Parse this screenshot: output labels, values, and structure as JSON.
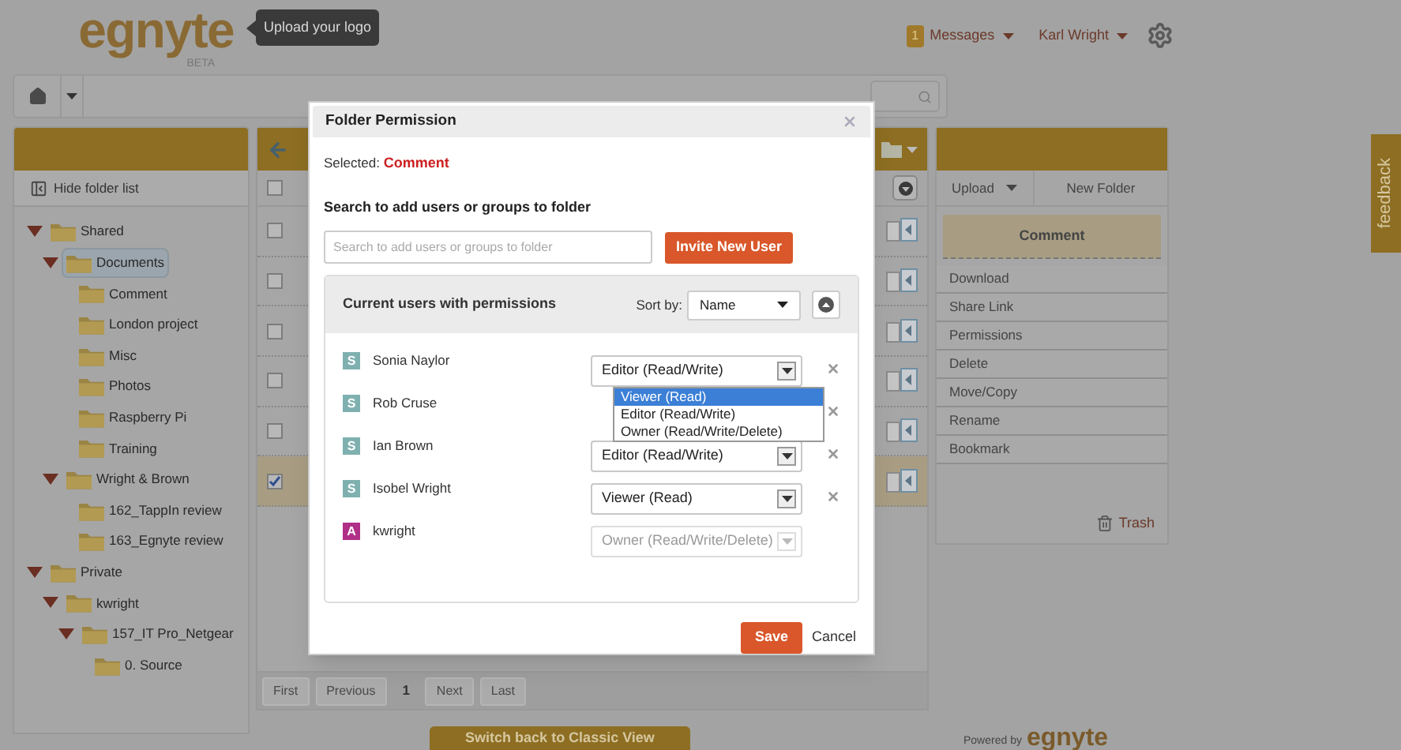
{
  "header": {
    "logo": "egnyte",
    "logo_sub": "BETA",
    "logo_tooltip": "Upload your logo",
    "messages_count": "1",
    "messages": "Messages",
    "user": "Karl Wright"
  },
  "folder_panel": {
    "hide_label": "Hide folder list",
    "tree": [
      {
        "label": "Shared",
        "expanded": true,
        "selected": false,
        "children": [
          {
            "label": "Documents",
            "expanded": true,
            "selected": true,
            "children": [
              {
                "label": "Comment",
                "selected": false
              },
              {
                "label": "London project",
                "selected": false
              },
              {
                "label": "Misc",
                "selected": false
              },
              {
                "label": "Photos",
                "selected": false
              },
              {
                "label": "Raspberry Pi",
                "selected": false
              },
              {
                "label": "Training",
                "selected": false
              }
            ]
          },
          {
            "label": "Wright & Brown",
            "expanded": true,
            "selected": false,
            "children": [
              {
                "label": "162_TappIn review",
                "selected": false
              },
              {
                "label": "163_Egnyte review",
                "selected": false
              }
            ]
          }
        ]
      },
      {
        "label": "Private",
        "expanded": true,
        "selected": false,
        "children": [
          {
            "label": "kwright",
            "expanded": true,
            "selected": false,
            "children": [
              {
                "label": "157_IT Pro_Netgear",
                "expanded": true,
                "selected": false,
                "children": [
                  {
                    "label": "0. Source",
                    "selected": false
                  }
                ]
              }
            ]
          }
        ]
      }
    ]
  },
  "file_list": {
    "header_checked": false,
    "rows": [
      {
        "checked": false,
        "selected": false
      },
      {
        "checked": false,
        "selected": false
      },
      {
        "checked": false,
        "selected": false
      },
      {
        "checked": false,
        "selected": false
      },
      {
        "checked": false,
        "selected": false
      },
      {
        "checked": true,
        "selected": true
      }
    ],
    "pagination": [
      {
        "label": "First",
        "kind": "button"
      },
      {
        "label": "Previous",
        "kind": "button"
      },
      {
        "label": "1",
        "kind": "page"
      },
      {
        "label": "Next",
        "kind": "button"
      },
      {
        "label": "Last",
        "kind": "button"
      }
    ]
  },
  "actions": {
    "upload": "Upload",
    "new_folder": "New Folder",
    "selected_item": "Comment",
    "items": [
      "Download",
      "Share Link",
      "Permissions",
      "Delete",
      "Move/Copy",
      "Rename",
      "Bookmark"
    ],
    "trash": "Trash"
  },
  "feedback": "feedback",
  "classic_view_button": "Switch back to Classic View",
  "powered_by": "Powered by",
  "footer_logo": "egnyte",
  "dialog": {
    "title": "Folder Permission",
    "selected_label": "Selected:",
    "selected_value": "Comment",
    "search_heading": "Search to add users or groups to folder",
    "search_placeholder": "Search to add users or groups to folder",
    "invite_button": "Invite New User",
    "users_heading": "Current users with permissions",
    "sort_label": "Sort by:",
    "sort_value": "Name",
    "users": [
      {
        "initial": "S",
        "name": "Sonia Naylor",
        "color": "#7fb0b0",
        "permission": "Editor (Read/Write)",
        "disabled": false,
        "removable": true,
        "options": [
          {
            "label": "Viewer (Read)",
            "selected": true
          },
          {
            "label": "Editor (Read/Write)",
            "selected": false
          },
          {
            "label": "Owner (Read/Write/Delete)",
            "selected": false
          }
        ]
      },
      {
        "initial": "S",
        "name": "Rob Cruse",
        "color": "#7fb0b0",
        "removable": true
      },
      {
        "initial": "S",
        "name": "Ian Brown",
        "color": "#7fb0b0",
        "permission": "Editor (Read/Write)",
        "disabled": false,
        "removable": true
      },
      {
        "initial": "S",
        "name": "Isobel Wright",
        "color": "#7fb0b0",
        "permission": "Viewer (Read)",
        "disabled": false,
        "removable": true
      },
      {
        "initial": "A",
        "name": "kwright",
        "color": "#b03088",
        "permission": "Owner (Read/Write/Delete)",
        "disabled": true,
        "removable": false
      }
    ],
    "save_button": "Save",
    "cancel_button": "Cancel"
  }
}
